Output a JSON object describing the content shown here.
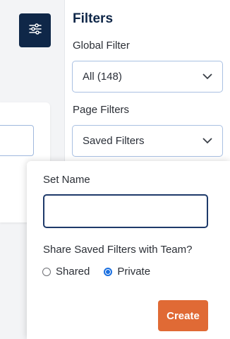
{
  "filter_toggle": {
    "icon": "sliders-icon"
  },
  "filters_panel": {
    "title": "Filters",
    "global_filter": {
      "label": "Global Filter",
      "selected": "All (148)"
    },
    "page_filters": {
      "label": "Page Filters",
      "selected": "Saved Filters"
    }
  },
  "save_popover": {
    "set_name_label": "Set Name",
    "set_name_value": "",
    "share_label": "Share Saved Filters with Team?",
    "options": [
      {
        "label": "Shared",
        "checked": false
      },
      {
        "label": "Private",
        "checked": true
      }
    ],
    "create_label": "Create"
  },
  "colors": {
    "navy": "#0f2748",
    "accent_orange": "#e06a35",
    "radio_blue": "#1a6fe0",
    "input_border": "#a9c0e2"
  }
}
